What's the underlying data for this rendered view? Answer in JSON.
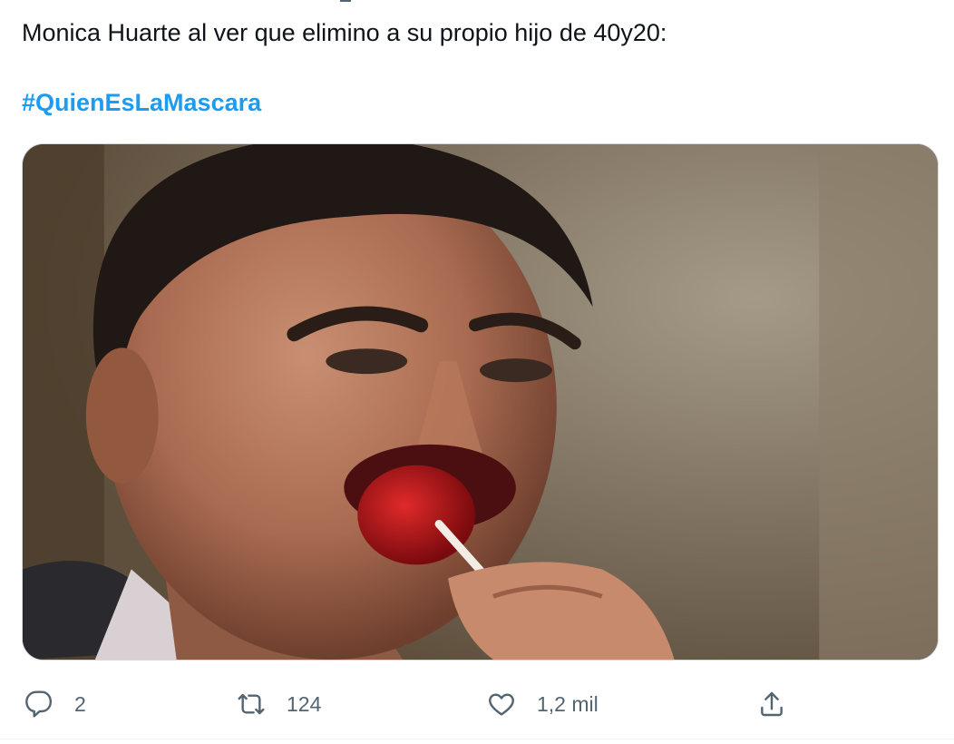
{
  "tweet": {
    "text": "Monica Huarte al ver que elimino a su propio hijo de 40y20:",
    "hashtag": "#QuienEsLaMascara"
  },
  "media": {
    "alt": "",
    "description_icon": "photo"
  },
  "actions": {
    "reply": {
      "icon": "reply-icon",
      "count": "2"
    },
    "retweet": {
      "icon": "retweet-icon",
      "count": "124"
    },
    "like": {
      "icon": "heart-icon",
      "count": "1,2 mil"
    },
    "share": {
      "icon": "share-icon"
    }
  },
  "colors": {
    "link": "#1d9bf0",
    "text": "#0f1419",
    "secondary": "#536471"
  }
}
